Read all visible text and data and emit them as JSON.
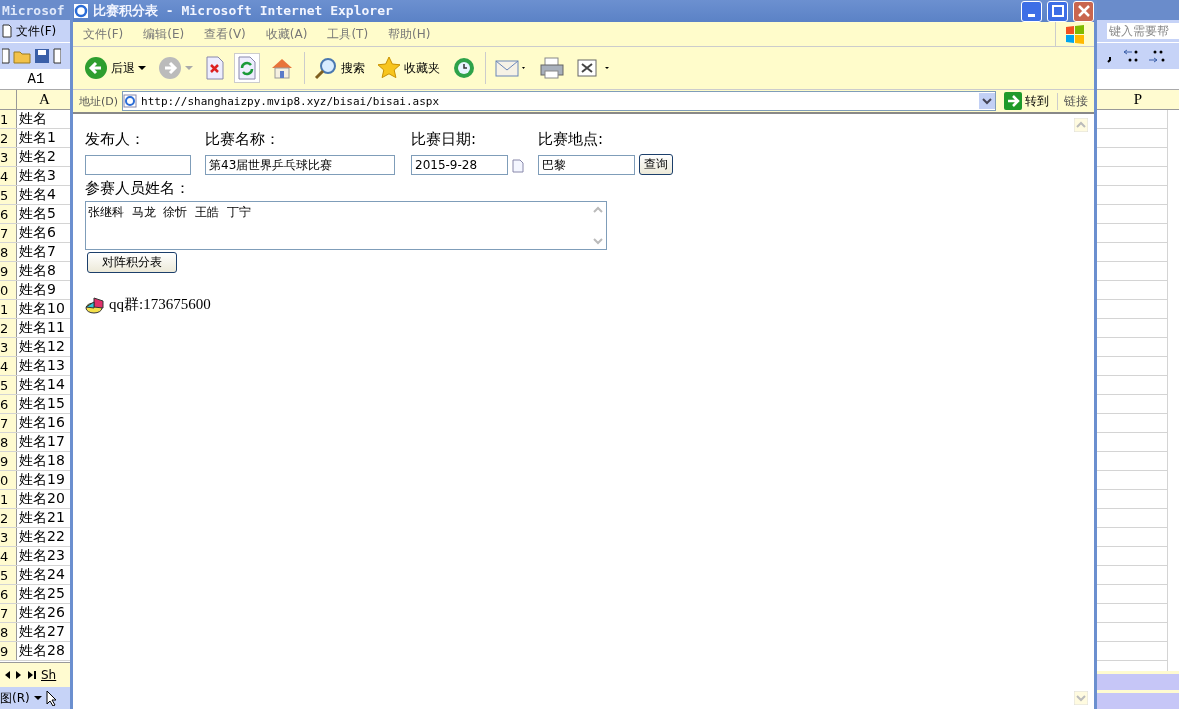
{
  "excel": {
    "title": "Microsof",
    "menu": "文件(F)",
    "name_box": "A1",
    "column_header": "A",
    "rows": [
      {
        "number": "1",
        "cell": "姓名"
      },
      {
        "number": "2",
        "cell": "姓名1"
      },
      {
        "number": "3",
        "cell": "姓名2"
      },
      {
        "number": "4",
        "cell": "姓名3"
      },
      {
        "number": "5",
        "cell": "姓名4"
      },
      {
        "number": "6",
        "cell": "姓名5"
      },
      {
        "number": "7",
        "cell": "姓名6"
      },
      {
        "number": "8",
        "cell": "姓名7"
      },
      {
        "number": "9",
        "cell": "姓名8"
      },
      {
        "number": "0",
        "cell": "姓名9"
      },
      {
        "number": "1",
        "cell": "姓名10"
      },
      {
        "number": "2",
        "cell": "姓名11"
      },
      {
        "number": "3",
        "cell": "姓名12"
      },
      {
        "number": "4",
        "cell": "姓名13"
      },
      {
        "number": "5",
        "cell": "姓名14"
      },
      {
        "number": "6",
        "cell": "姓名15"
      },
      {
        "number": "7",
        "cell": "姓名16"
      },
      {
        "number": "8",
        "cell": "姓名17"
      },
      {
        "number": "9",
        "cell": "姓名18"
      },
      {
        "number": "0",
        "cell": "姓名19"
      },
      {
        "number": "1",
        "cell": "姓名20"
      },
      {
        "number": "2",
        "cell": "姓名21"
      },
      {
        "number": "3",
        "cell": "姓名22"
      },
      {
        "number": "4",
        "cell": "姓名23"
      },
      {
        "number": "5",
        "cell": "姓名24"
      },
      {
        "number": "6",
        "cell": "姓名25"
      },
      {
        "number": "7",
        "cell": "姓名26"
      },
      {
        "number": "8",
        "cell": "姓名27"
      },
      {
        "number": "9",
        "cell": "姓名28"
      }
    ],
    "sheet_tab": "Sh",
    "drawing_menu": "图(R)",
    "help_field": {
      "placeholder": "键入需要帮"
    },
    "right_column_header": "P"
  },
  "ie": {
    "title": "比赛积分表 - Microsoft Internet Explorer",
    "menu": [
      "文件(F)",
      "编辑(E)",
      "查看(V)",
      "收藏(A)",
      "工具(T)",
      "帮助(H)"
    ],
    "toolbar": [
      {
        "kind": "back",
        "label": "后退"
      },
      {
        "kind": "forward"
      },
      {
        "kind": "stop"
      },
      {
        "kind": "refresh"
      },
      {
        "kind": "home"
      },
      {
        "kind": "search",
        "label": "搜索"
      },
      {
        "kind": "favorites",
        "label": "收藏夹"
      },
      {
        "kind": "history"
      },
      {
        "kind": "mail"
      },
      {
        "kind": "print"
      },
      {
        "kind": "edit"
      }
    ],
    "address": {
      "label": "地址(D)",
      "url": "http://shanghaizpy.mvip8.xyz/bisai/bisai.aspx",
      "go": "转到",
      "links": "链接"
    },
    "form": {
      "fields": [
        {
          "kind": "text",
          "label": "发布人："
        },
        {
          "kind": "text",
          "label": "比赛名称：",
          "value": "第43届世界乒乓球比赛"
        },
        {
          "kind": "date",
          "label": "比赛日期:",
          "value": "2015-9-28"
        },
        {
          "kind": "text",
          "label": "比赛地点:",
          "value": "巴黎"
        }
      ],
      "query_button": "查询",
      "participants_label": "参赛人员姓名：",
      "participants": "张继科  马龙  徐忻  王皓  丁宁",
      "table_button": "对阵积分表",
      "qq": "qq群:173675600"
    }
  }
}
